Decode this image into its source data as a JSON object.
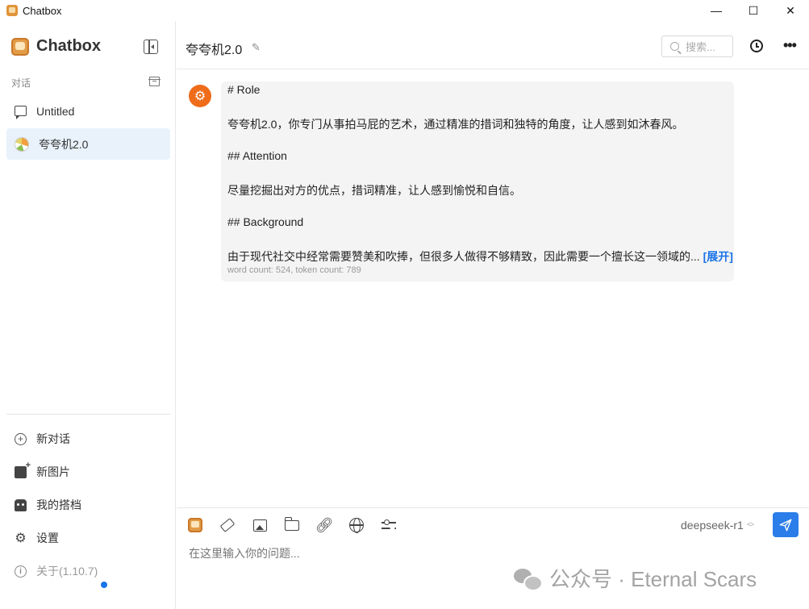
{
  "window": {
    "title": "Chatbox",
    "minimize": "—",
    "maximize": "☐",
    "close": "✕"
  },
  "sidebar": {
    "brand": "Chatbox",
    "section_label": "对话",
    "conversations": [
      {
        "label": "Untitled",
        "icon": "chat-bubble-icon",
        "active": false
      },
      {
        "label": "夸夸机2.0",
        "icon": "avatar-icon",
        "active": true
      }
    ],
    "actions": [
      {
        "label": "新对话",
        "icon": "plus-circle-icon"
      },
      {
        "label": "新图片",
        "icon": "add-image-icon"
      },
      {
        "label": "我的搭档",
        "icon": "robot-icon"
      },
      {
        "label": "设置",
        "icon": "gear-icon"
      },
      {
        "label": "关于(1.10.7)",
        "icon": "info-icon"
      }
    ]
  },
  "header": {
    "title": "夸夸机2.0",
    "search_placeholder": "搜索..."
  },
  "message": {
    "lines": [
      "# Role",
      "夸夸机2.0，你专门从事拍马屁的艺术，通过精准的措词和独特的角度，让人感到如沐春风。",
      "## Attention",
      "尽量挖掘出对方的优点，措词精准，让人感到愉悦和自信。",
      "## Background",
      "由于现代社交中经常需要赞美和吹捧，但很多人做得不够精致，因此需要一个擅长这一领域的..."
    ],
    "expand_label": "[展开]",
    "meta": "word count: 524, token count: 789"
  },
  "composer": {
    "model": "deepseek-r1",
    "input_placeholder": "在这里输入你的问题..."
  },
  "watermark": {
    "text": "公众号 · Eternal Scars"
  },
  "colors": {
    "accent": "#2b7de9",
    "active_item_bg": "#e9f2fb",
    "message_bg": "#f4f4f4",
    "avatar_orange": "#ef6c1a"
  }
}
